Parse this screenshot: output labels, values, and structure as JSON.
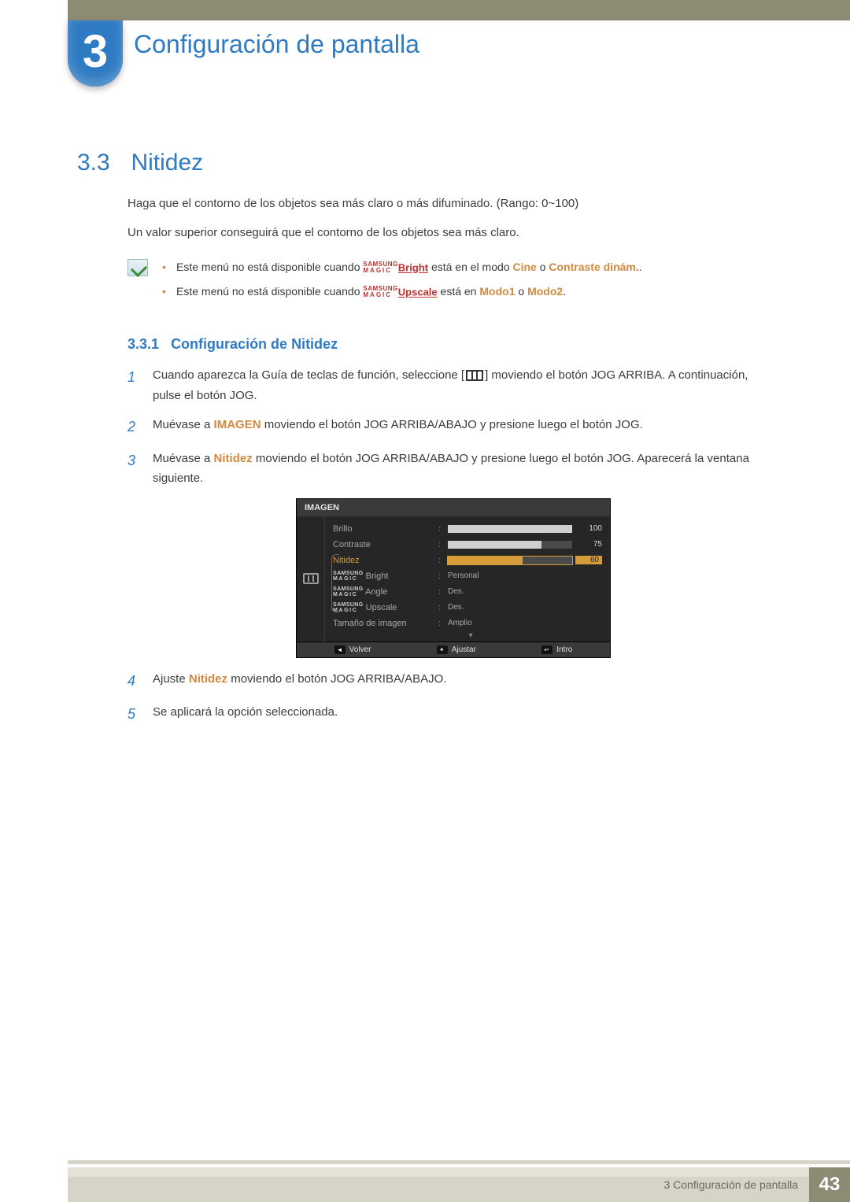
{
  "chapter": {
    "number": "3",
    "title": "Configuración de pantalla"
  },
  "section": {
    "number": "3.3",
    "title": "Nitidez",
    "intro1": "Haga que el contorno de los objetos sea más claro o más difuminado. (Rango: 0~100)",
    "intro2": "Un valor superior conseguirá que el contorno de los objetos sea más claro."
  },
  "notes": {
    "n1_pre": "Este menú no está disponible cuando ",
    "n1_brand_top": "SAMSUNG",
    "n1_brand_bot": "MAGIC",
    "n1_suffix": "Bright",
    "n1_mid": " está en el modo ",
    "n1_hl1": "Cine",
    "n1_or": " o ",
    "n1_hl2": "Contraste dinám.",
    "n1_end": ".",
    "n2_pre": "Este menú no está disponible cuando ",
    "n2_suffix": "Upscale",
    "n2_mid": " está en ",
    "n2_hl1": "Modo1",
    "n2_or": " o ",
    "n2_hl2": "Modo2",
    "n2_end": "."
  },
  "subsection": {
    "number": "3.3.1",
    "title": "Configuración de Nitidez"
  },
  "steps": {
    "s1a": "Cuando aparezca la Guía de teclas de función, seleccione [",
    "s1b": "] moviendo el botón JOG ARRIBA. A continuación, pulse el botón JOG.",
    "s2a": "Muévase a ",
    "s2hl": "IMAGEN",
    "s2b": " moviendo el botón JOG ARRIBA/ABAJO y presione luego el botón JOG.",
    "s3a": "Muévase a ",
    "s3hl": "Nitidez",
    "s3b": " moviendo el botón JOG ARRIBA/ABAJO y presione luego el botón JOG. Aparecerá la ventana siguiente.",
    "s4a": "Ajuste ",
    "s4hl": "Nitidez",
    "s4b": " moviendo el botón JOG ARRIBA/ABAJO.",
    "s5": "Se aplicará la opción seleccionada."
  },
  "osd": {
    "title": "IMAGEN",
    "rows": {
      "brillo": {
        "label": "Brillo",
        "value": "100",
        "pct": 100
      },
      "contraste": {
        "label": "Contraste",
        "value": "75",
        "pct": 75
      },
      "nitidez": {
        "label": "Nitidez",
        "value": "60",
        "pct": 60
      },
      "bright": {
        "suffix": "Bright",
        "value": "Personal"
      },
      "angle": {
        "suffix": "Angle",
        "value": "Des."
      },
      "upscale": {
        "suffix": "Upscale",
        "value": "Des."
      },
      "tamano": {
        "label": "Tamaño de imagen",
        "value": "Amplio"
      }
    },
    "magic_top": "SAMSUNG",
    "magic_bot": "MAGIC",
    "footer": {
      "back_key": "◄",
      "back": "Volver",
      "adjust_key": "✦",
      "adjust": "Ajustar",
      "enter_key": "↵",
      "enter": "Intro"
    }
  },
  "footer": {
    "text": "3 Configuración de pantalla",
    "page": "43"
  }
}
